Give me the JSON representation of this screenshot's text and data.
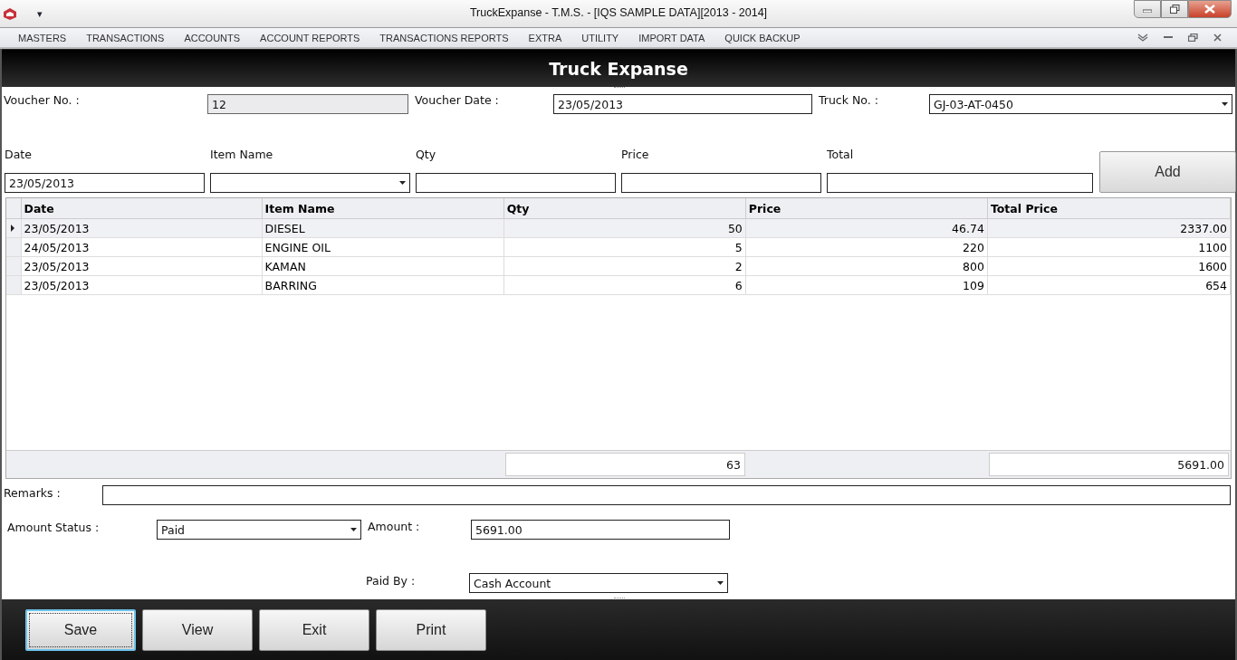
{
  "window": {
    "title": "TruckExpanse - T.M.S. - [IQS SAMPLE DATA][2013 - 2014]",
    "quick_access": "▾"
  },
  "menu": [
    "MASTERS",
    "TRANSACTIONS",
    "ACCOUNTS",
    "ACCOUNT REPORTS",
    "TRANSACTIONS REPORTS",
    "EXTRA",
    "UTILITY",
    "IMPORT DATA",
    "QUICK BACKUP"
  ],
  "form_title": "Truck Expanse",
  "voucher": [
    {
      "label": "Voucher No. :",
      "value": "12",
      "kind": "readonly"
    },
    {
      "label": "Voucher Date :",
      "value": "23/05/2013",
      "kind": "text"
    },
    {
      "label": "Truck No. :",
      "value": "GJ-03-AT-0450",
      "kind": "dropdown"
    }
  ],
  "entry": {
    "fields": [
      {
        "label": "Date",
        "value": "23/05/2013",
        "kind": "text"
      },
      {
        "label": "Item Name",
        "kind": "dropdown"
      },
      {
        "label": "Qty",
        "kind": "text"
      },
      {
        "label": "Price",
        "kind": "text"
      },
      {
        "label": "Total",
        "kind": "text"
      }
    ],
    "add_button": "Add"
  },
  "table": {
    "columns": [
      "Date",
      "Item Name",
      "Qty",
      "Price",
      "Total Price"
    ],
    "rows": [
      {
        "cells": [
          "23/05/2013",
          "DIESEL",
          "50",
          "46.74",
          "2337.00"
        ],
        "selected": true
      },
      {
        "cells": [
          "24/05/2013",
          "ENGINE OIL",
          "5",
          "220",
          "1100"
        ],
        "selected": false
      },
      {
        "cells": [
          "23/05/2013",
          "KAMAN",
          "2",
          "800",
          "1600"
        ],
        "selected": false
      },
      {
        "cells": [
          "23/05/2013",
          "BARRING",
          "6",
          "109",
          "654"
        ],
        "selected": false
      }
    ],
    "totals": {
      "qty": "63",
      "total_price": "5691.00"
    }
  },
  "remarks": {
    "label": "Remarks :"
  },
  "payment": {
    "status_label": "Amount Status :",
    "status": "Paid",
    "amount_label": "Amount :",
    "amount": "5691.00",
    "paid_by_label": "Paid By :",
    "paid_by": "Cash Account"
  },
  "buttons": [
    {
      "label": "Save",
      "focused": true
    },
    {
      "label": "View",
      "focused": false
    },
    {
      "label": "Exit",
      "focused": false
    },
    {
      "label": "Print",
      "focused": false
    }
  ]
}
